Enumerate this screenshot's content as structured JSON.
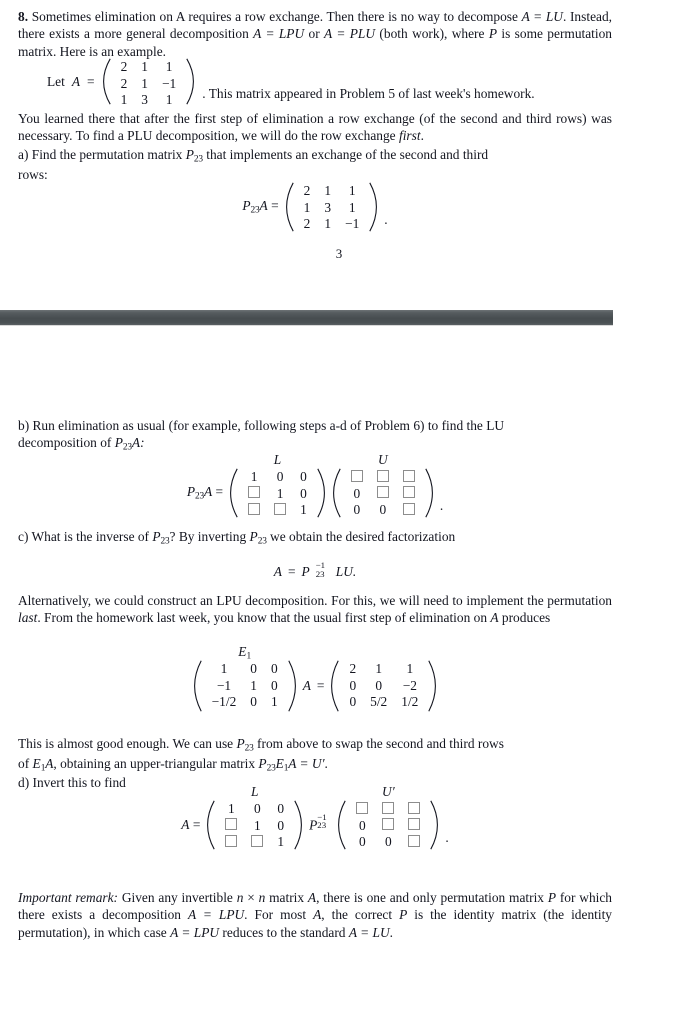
{
  "document": {
    "page_number": "3",
    "text_color": "#13151f",
    "separator_color": "#4b5154",
    "box_border_color": "#8d8d8d"
  },
  "problem": {
    "number": "8.",
    "intro_line1": "Sometimes elimination on A requires a row exchange. Then there is no way to decompose",
    "intro_line2_a": "A = LU",
    "intro_line2_b": ". Instead, there exists a more general decomposition ",
    "intro_line2_c": "A = LPU",
    "intro_line2_d": " or ",
    "intro_line2_e": "A = PLU",
    "intro_line2_f": " (both",
    "intro_line3_a": "work), where ",
    "intro_line3_b": "P",
    "intro_line3_c": " is some permutation matrix. Here is an example.",
    "let_label": "Let",
    "let_var": "A",
    "let_eq": "=",
    "let_tail": ". This matrix appeared in Problem 5 of last week's homework.",
    "matrix_A": {
      "name": "A",
      "rows": [
        [
          "2",
          "1",
          "1"
        ],
        [
          "2",
          "1",
          "−1"
        ],
        [
          "1",
          "3",
          "1"
        ]
      ]
    },
    "body1_line1": "You learned there that after the first step of elimination a row exchange (of the second and",
    "body1_line2_a": "third rows) was necessary. To find a PLU decomposition, we will do the row exchange ",
    "body1_line2_b": "first",
    "body1_line2_c": ".",
    "part_a_line1_a": "a) Find the permutation matrix ",
    "part_a_line1_b": "P",
    "part_a_line1_sub": "23",
    "part_a_line1_c": " that implements an exchange of the second and third",
    "part_a_line2": "rows:",
    "eq_P23A": {
      "lead_var": "P",
      "lead_sub": "23",
      "lead_var2": "A",
      "lead_eq": "=",
      "tail": ".",
      "rows": [
        [
          "2",
          "1",
          "1"
        ],
        [
          "1",
          "3",
          "1"
        ],
        [
          "2",
          "1",
          "−1"
        ]
      ]
    }
  },
  "part_b": {
    "line1": "b) Run elimination as usual (for example, following steps a-d of Problem 6) to find the LU",
    "line2_a": "decomposition of ",
    "line2_b": "P",
    "line2_sub": "23",
    "line2_c": "A:",
    "equation": {
      "lead_var": "P",
      "lead_sub": "23",
      "lead_var2": "A",
      "lead_eq": "=",
      "tail": ".",
      "L": {
        "label": "L",
        "rows": [
          [
            "1",
            "0",
            "0"
          ],
          [
            "□",
            "1",
            "0"
          ],
          [
            "□",
            "□",
            "1"
          ]
        ]
      },
      "U": {
        "label": "U",
        "rows": [
          [
            "□",
            "□",
            "□"
          ],
          [
            "0",
            "□",
            "□"
          ],
          [
            "0",
            "0",
            "□"
          ]
        ]
      }
    }
  },
  "part_c": {
    "line1_a": "c) What is the inverse of ",
    "line1_b": "P",
    "line1_sub1": "23",
    "line1_c": "? By inverting ",
    "line1_d": "P",
    "line1_sub2": "23",
    "line1_e": " we obtain the desired factorization",
    "equation": {
      "lhs": "A",
      "eq": "=",
      "P": "P",
      "P_sup": "−1",
      "P_sub": "23",
      "rhs": "LU.",
      "full_text": "A = P₃₃⁻¹LU."
    },
    "alt_line1": "Alternatively, we could construct an LPU decomposition. For this, we will need to implement",
    "alt_line2_a": "the permutation ",
    "alt_line2_b": "last",
    "alt_line2_c": ". From the homework last week, you know that the usual first step of",
    "alt_line3_a": "elimination on ",
    "alt_line3_b": "A",
    "alt_line3_c": " produces",
    "equation_E1": {
      "E1": {
        "label": "E",
        "label_sub": "1",
        "rows": [
          [
            "1",
            "0",
            "0"
          ],
          [
            "−1",
            "1",
            "0"
          ],
          [
            "−1/2",
            "0",
            "1"
          ]
        ]
      },
      "mid_var": "A",
      "mid_eq": "=",
      "result": {
        "rows": [
          [
            "2",
            "1",
            "1"
          ],
          [
            "0",
            "0",
            "−2"
          ],
          [
            "0",
            "5/2",
            "1/2"
          ]
        ]
      }
    }
  },
  "part_d": {
    "line1_a": "This is almost good enough. We can use ",
    "line1_b": "P",
    "line1_sub": "23",
    "line1_c": " from above to swap the second and third rows",
    "line2_a": "of ",
    "line2_b": "E",
    "line2_sub1": "1",
    "line2_c": "A",
    "line2_d": ", obtaining an upper-triangular matrix ",
    "line2_e": "P",
    "line2_sub2": "23",
    "line2_f": "E",
    "line2_sub3": "1",
    "line2_g": "A = U′",
    "line2_h": ".",
    "line3": "d) Invert this to find",
    "equation": {
      "lhs": "A",
      "eq": "=",
      "P": "P",
      "P_sup": "−1",
      "P_sub": "23",
      "tail": ".",
      "L": {
        "label": "L",
        "rows": [
          [
            "1",
            "0",
            "0"
          ],
          [
            "□",
            "1",
            "0"
          ],
          [
            "□",
            "□",
            "1"
          ]
        ]
      },
      "U": {
        "label": "U′",
        "rows": [
          [
            "□",
            "□",
            "□"
          ],
          [
            "0",
            "□",
            "□"
          ],
          [
            "0",
            "0",
            "□"
          ]
        ]
      }
    }
  },
  "remark": {
    "title": "Important remark:",
    "line1_b": " Given any invertible ",
    "line1_n1": "n",
    "line1_times": " × ",
    "line1_n2": "n",
    "line1_c": " matrix ",
    "line1_A": "A",
    "line1_d": ", there is one and only permutation",
    "line2_a": "matrix ",
    "line2_P": "P",
    "line2_b": " for which there exists a decomposition ",
    "line2_eq": "A = LPU",
    "line2_c": ". For most ",
    "line2_A": "A",
    "line2_d": ", the correct ",
    "line2_P2": "P",
    "line2_e": " is the",
    "line3_a": "identity matrix (the identity permutation), in which case ",
    "line3_eq": "A = LPU",
    "line3_b": " reduces to the standard",
    "line4": "A = LU",
    "line4_tail": "."
  }
}
